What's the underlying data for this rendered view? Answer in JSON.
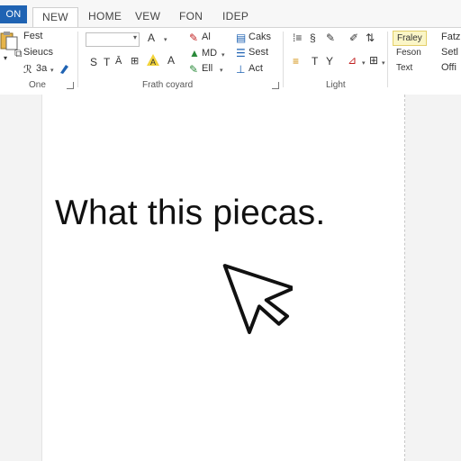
{
  "tabs": {
    "file": "ON",
    "new": "NEW",
    "home": "HOME",
    "view": "VEW",
    "fon": "FON",
    "idep": "IDEP"
  },
  "ribbon": {
    "clipboard": {
      "fest": "Fest",
      "sieucs": "Sieucs",
      "size": "3a",
      "label": "One"
    },
    "font": {
      "label": "Frath coyard",
      "letters": [
        "S",
        "T",
        "A"
      ]
    },
    "editing": {
      "al": "Al",
      "md": "MD",
      "ell": "Ell",
      "caks": "Caks",
      "sest": "Sest",
      "act": "Act"
    },
    "paragraph": {
      "label": "Light"
    },
    "styles": {
      "items": [
        "Fraley",
        "Feson",
        "Text"
      ],
      "items2": [
        "Fatz",
        "Setl",
        "Offi"
      ]
    }
  },
  "document": {
    "text": "What this piecas."
  }
}
